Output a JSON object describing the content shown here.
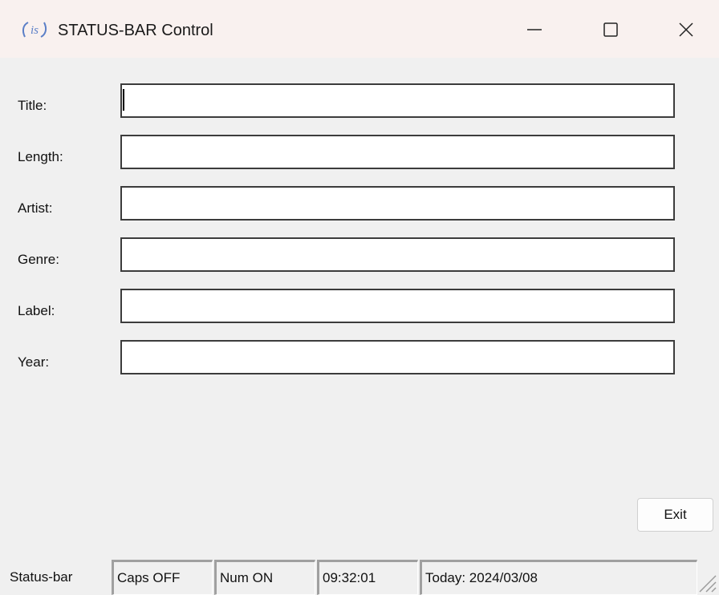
{
  "window": {
    "title": "STATUS-BAR Control",
    "icon": "is-logo-icon",
    "icon_text": "is",
    "caption_buttons": [
      "minimize-icon",
      "maximize-icon",
      "close-icon"
    ]
  },
  "form": {
    "fields": [
      {
        "label": "Title:",
        "value": ""
      },
      {
        "label": "Length:",
        "value": ""
      },
      {
        "label": "Artist:",
        "value": ""
      },
      {
        "label": "Genre:",
        "value": ""
      },
      {
        "label": "Label:",
        "value": ""
      },
      {
        "label": "Year:",
        "value": ""
      }
    ],
    "exit_label": "Exit"
  },
  "statusbar": {
    "panes": [
      "Status-bar",
      "Caps OFF",
      "Num ON",
      "09:32:01",
      "Today: 2024/03/08"
    ]
  },
  "colors": {
    "titlebar_bg": "#f9f1ef",
    "window_bg": "#f0f0f0",
    "icon_accent": "#5b7fc7"
  }
}
